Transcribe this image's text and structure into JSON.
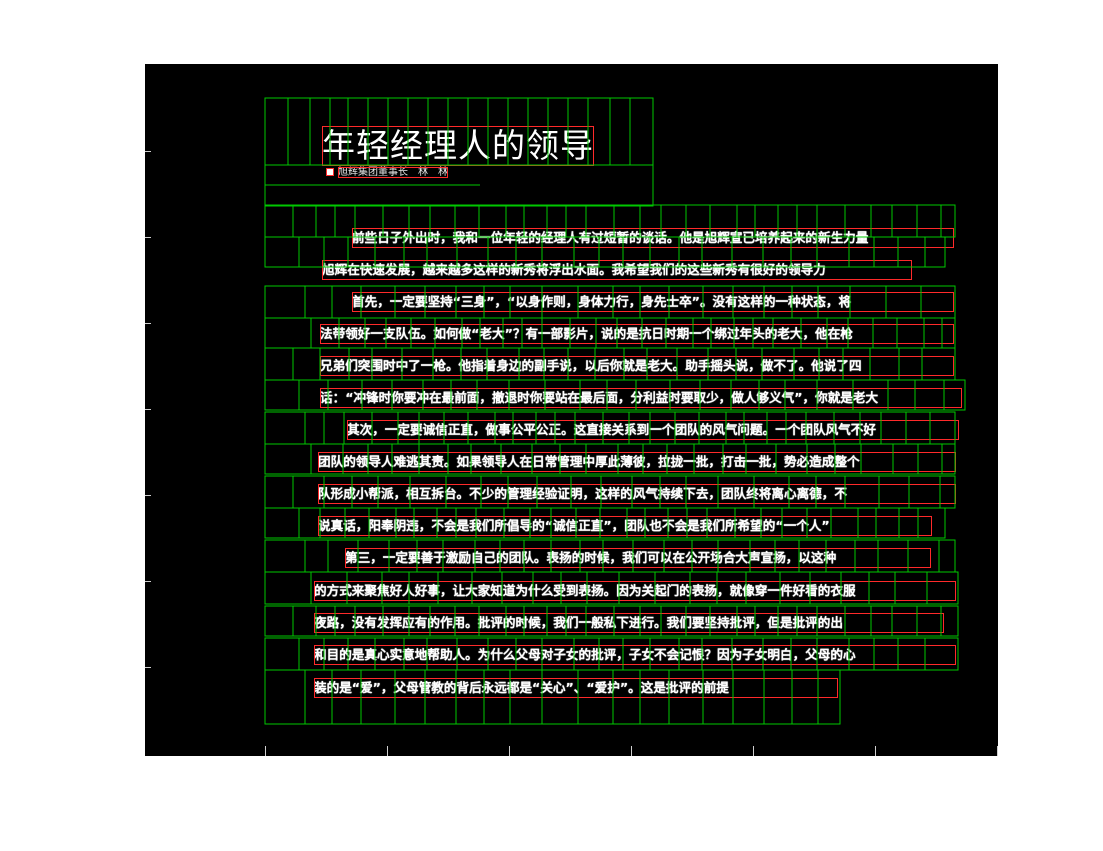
{
  "title": "年轻经理人的领导",
  "byline": "旭辉集团董事长　林　林",
  "paragraphs": [
    "前些日子外出时，我和一位年轻的经理人有过短暂的谈话。他是旭辉宣已培养起来的新生力量",
    "旭辉在快速发展，越来越多这样的新秀将浮出水面。我希望我们的这些新秀有很好的领导力",
    "首先，一定要坚持“三身”，“以身作则，身体力行，身先士卒”。没有这样的一种状态，将",
    "法带领好一支队伍。如何做“老大”？有一部影片，说的是抗日时期一个绑过年头的老大，他在枪",
    "兄弟们突围时中了一枪。他指着身边的副手说，以后你就是老大。助手摇头说，做不了。他说了四",
    "话：“冲锋时你要冲在最前面，撤退时你要站在最后面，分利益时要取少，做人够义气”，你就是老大",
    "其次，一定要诚信正直，做事公平公正。这直接关系到一个团队的风气问题。一个团队风气不好",
    "团队的领导人难逃其责。如果领导人在日常管理中厚此薄彼，拉拢一批，打击一批，势必造成整个",
    "队形成小帮派，相互拆台。不少的管理经验证明，这样的风气持续下去，团队终将离心离德，不",
    "说真话，阳奉阴违，不会是我们所倡导的“诚信正直”，团队也不会是我们所希望的“一个人”",
    "第三，一定要善于激励自己的团队。表扬的时候，我们可以在公开场合大声宣扬，以这种",
    "的方式来聚焦好人好事，让大家知道为什么受到表扬。因为关起门的表扬，就像穿一件好看的衣服",
    "夜路，没有发挥应有的作用。批评的时候，我们一般私下进行。我们要坚持批评，但是批评的出",
    "和目的是真心实意地帮助人。为什么父母对子女的批评，子女不会记恨？因为子女明白，父母的心",
    "装的是“爱”，父母管教的背后永远都是“关心”、“爱护”。这是批评的前提"
  ],
  "colors": {
    "background": "#000000",
    "grid": "#00c800",
    "box": "#ff2a2a",
    "text": "#ffffff"
  }
}
